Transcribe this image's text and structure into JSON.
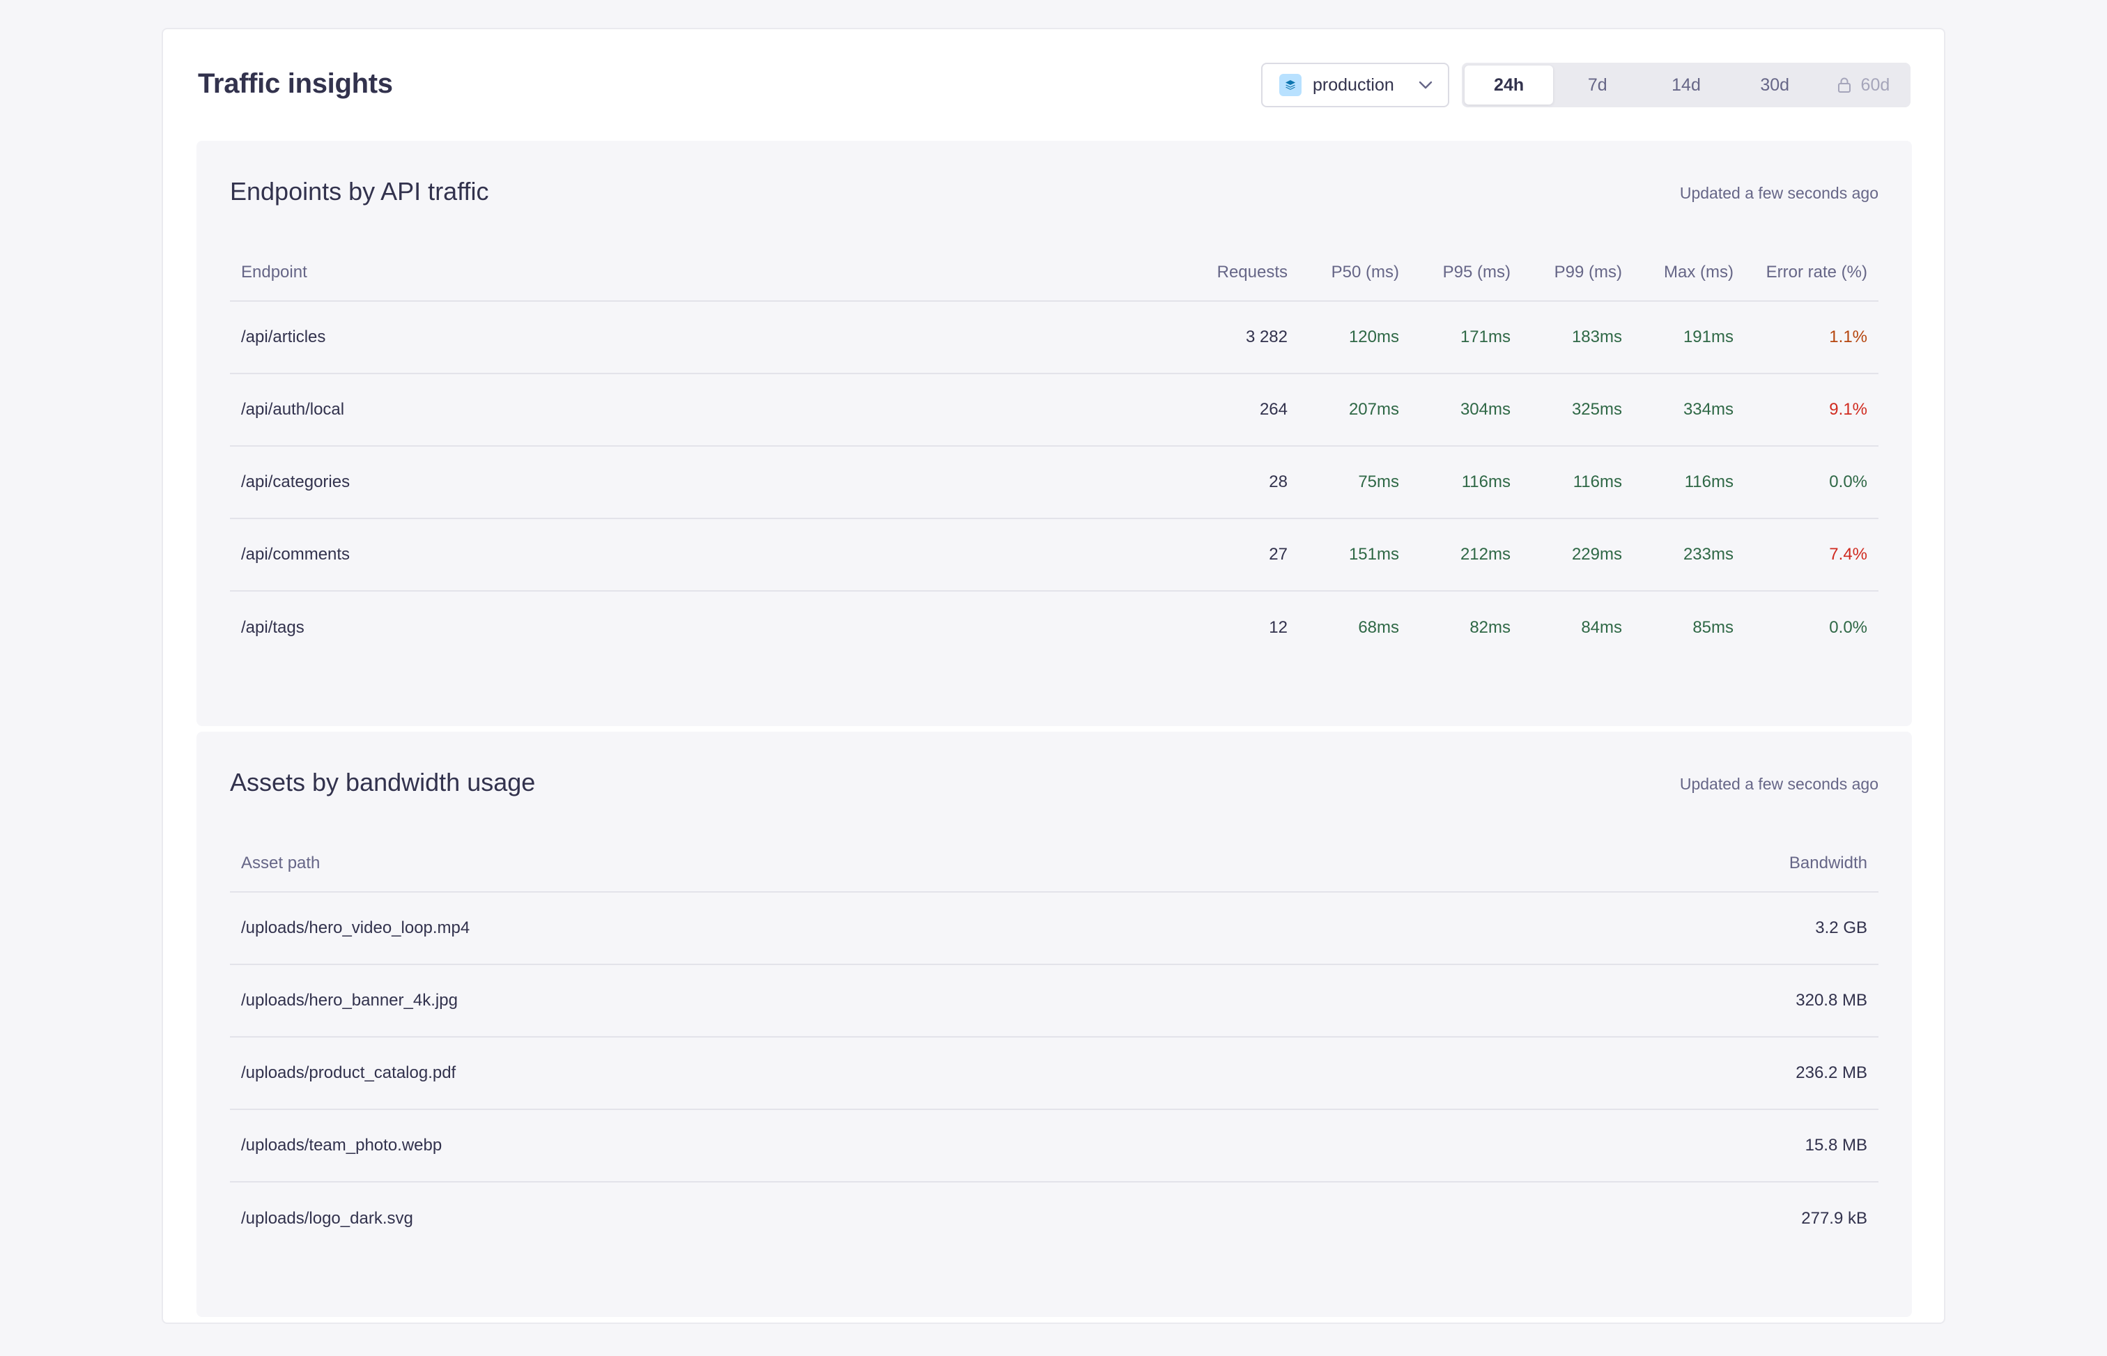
{
  "header": {
    "title": "Traffic insights",
    "environment": "production",
    "ranges": [
      {
        "label": "24h",
        "active": true,
        "locked": false
      },
      {
        "label": "7d",
        "active": false,
        "locked": false
      },
      {
        "label": "14d",
        "active": false,
        "locked": false
      },
      {
        "label": "30d",
        "active": false,
        "locked": false
      },
      {
        "label": "60d",
        "active": false,
        "locked": true
      }
    ]
  },
  "endpoints": {
    "title": "Endpoints by API traffic",
    "updated": "Updated a few seconds ago",
    "columns": [
      "Endpoint",
      "Requests",
      "P50 (ms)",
      "P95 (ms)",
      "P99 (ms)",
      "Max (ms)",
      "Error rate (%)"
    ],
    "rows": [
      {
        "endpoint": "/api/articles",
        "requests": "3 282",
        "p50": "120ms",
        "p95": "171ms",
        "p99": "183ms",
        "max": "191ms",
        "error": "1.1%"
      },
      {
        "endpoint": "/api/auth/local",
        "requests": "264",
        "p50": "207ms",
        "p95": "304ms",
        "p99": "325ms",
        "max": "334ms",
        "error": "9.1%"
      },
      {
        "endpoint": "/api/categories",
        "requests": "28",
        "p50": "75ms",
        "p95": "116ms",
        "p99": "116ms",
        "max": "116ms",
        "error": "0.0%"
      },
      {
        "endpoint": "/api/comments",
        "requests": "27",
        "p50": "151ms",
        "p95": "212ms",
        "p99": "229ms",
        "max": "233ms",
        "error": "7.4%"
      },
      {
        "endpoint": "/api/tags",
        "requests": "12",
        "p50": "68ms",
        "p95": "82ms",
        "p99": "84ms",
        "max": "85ms",
        "error": "0.0%"
      }
    ]
  },
  "assets": {
    "title": "Assets by bandwidth usage",
    "updated": "Updated a few seconds ago",
    "columns": [
      "Asset path",
      "Bandwidth"
    ],
    "rows": [
      {
        "path": "/uploads/hero_video_loop.mp4",
        "bandwidth": "3.2 GB"
      },
      {
        "path": "/uploads/hero_banner_4k.jpg",
        "bandwidth": "320.8 MB"
      },
      {
        "path": "/uploads/product_catalog.pdf",
        "bandwidth": "236.2 MB"
      },
      {
        "path": "/uploads/team_photo.webp",
        "bandwidth": "15.8 MB"
      },
      {
        "path": "/uploads/logo_dark.svg",
        "bandwidth": "277.9 kB"
      }
    ]
  },
  "colors": {
    "latency": "#2f6846",
    "error_low": "#2f6846",
    "error_mid": "#b5460f",
    "error_high": "#d02b20",
    "environment_icon_bg": "#b8e1ff"
  },
  "icons": {
    "environment": "layers-icon",
    "dropdown": "chevron-down-icon",
    "locked_range": "lock-icon"
  }
}
